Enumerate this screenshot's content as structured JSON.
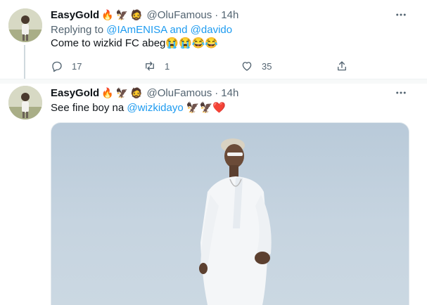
{
  "tweets": [
    {
      "display_name": "EasyGold",
      "name_emojis": [
        "🔥",
        "🦅",
        "🧔"
      ],
      "handle": "@OluFamous",
      "separator": "·",
      "time": "14h",
      "replying_label": "Replying to",
      "replying_users": "@IAmENISA and @davido",
      "text": "Come to wizkid FC abeg😭😭😂😂",
      "reply_count": "17",
      "retweet_count": "1",
      "like_count": "35",
      "more_icon": "more-horizontal-icon"
    },
    {
      "display_name": "EasyGold",
      "name_emojis": [
        "🔥",
        "🦅",
        "🧔"
      ],
      "handle": "@OluFamous",
      "separator": "·",
      "time": "14h",
      "text_before": "See fine boy na ",
      "mention": "@wizkidayo",
      "text_after": " 🦅🦅❤️",
      "more_icon": "more-horizontal-icon"
    }
  ],
  "colors": {
    "link": "#1d9bf0",
    "muted": "#536471",
    "text": "#0f1419",
    "border": "#eff3f4",
    "photo_background": "#c6d4e0"
  }
}
